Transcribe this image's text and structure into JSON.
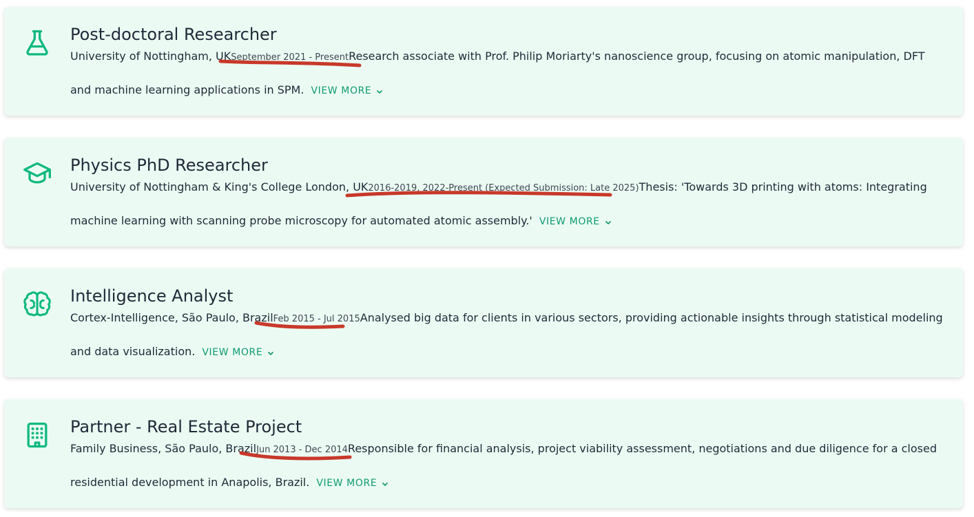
{
  "accent_color": "#10b981",
  "link_color": "#0f9a72",
  "annotation_color": "#c8382a",
  "entries": [
    {
      "icon": "flask-icon",
      "title": "Post-doctoral Researcher",
      "org": "University of Nottingham, UK",
      "dates": "September 2021 - Present",
      "description": "Research associate with Prof. Philip Moriarty's nanoscience group, focusing on atomic manipulation, DFT and machine learning applications in SPM.",
      "view_more": "VIEW MORE"
    },
    {
      "icon": "graduation-cap-icon",
      "title": "Physics PhD Researcher",
      "org": "University of Nottingham & King's College London, UK",
      "dates": "2016-2019, 2022-Present (Expected Submission: Late 2025)",
      "description": "Thesis: 'Towards 3D printing with atoms: Integrating machine learning with scanning probe microscopy for automated atomic assembly.'",
      "view_more": "VIEW MORE"
    },
    {
      "icon": "brain-icon",
      "title": "Intelligence Analyst",
      "org": "Cortex-Intelligence, São Paulo, Brazil",
      "dates": "Feb 2015 - Jul 2015",
      "description": "Analysed big data for clients in various sectors, providing actionable insights through statistical modeling and data visualization.",
      "view_more": "VIEW MORE"
    },
    {
      "icon": "building-icon",
      "title": "Partner - Real Estate Project",
      "org": "Family Business, São Paulo, Brazil",
      "dates": "Jun 2013 - Dec 2014",
      "description": "Responsible for financial analysis, project viability assessment, negotiations and due diligence for a closed residential development in Anapolis, Brazil.",
      "view_more": "VIEW MORE"
    }
  ]
}
